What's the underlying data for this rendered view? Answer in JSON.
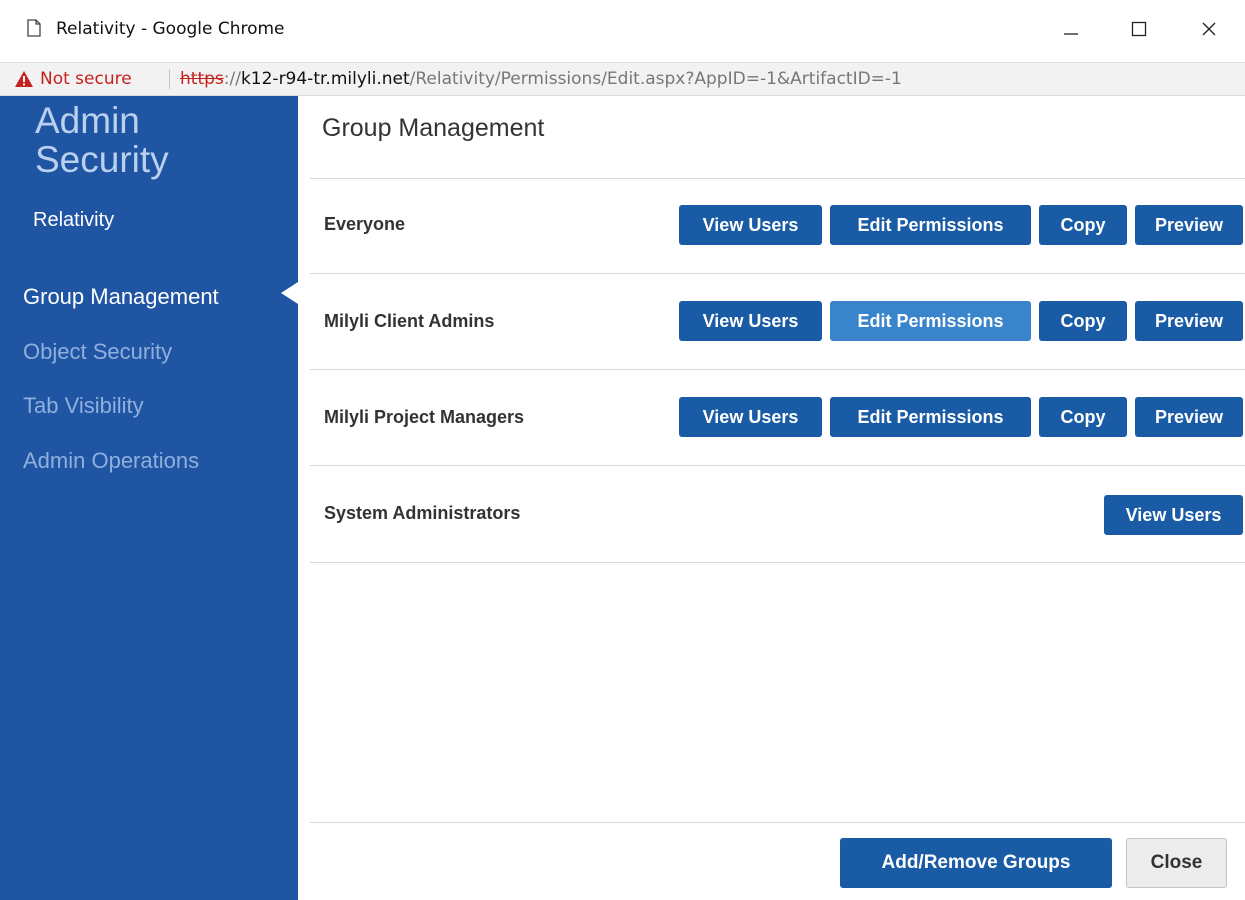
{
  "window": {
    "title": "Relativity - Google Chrome",
    "icons": {
      "page": "page-icon",
      "minimize": "minimize-icon",
      "maximize": "maximize-icon",
      "close": "close-icon"
    }
  },
  "addressbar": {
    "security_label": "Not secure",
    "url_scheme": "https",
    "url_sep": "://",
    "url_host": "k12-r94-tr.milyli.net",
    "url_path": "/Relativity/Permissions/Edit.aspx?AppID=-1&ArtifactID=-1",
    "icon": "warning-icon"
  },
  "sidebar": {
    "title": "Admin Security",
    "subtitle": "Relativity",
    "items": [
      {
        "label": "Group Management",
        "active": true
      },
      {
        "label": "Object Security",
        "active": false
      },
      {
        "label": "Tab Visibility",
        "active": false
      },
      {
        "label": "Admin Operations",
        "active": false
      }
    ]
  },
  "main": {
    "title": "Group Management",
    "groups": [
      {
        "name": "Everyone",
        "buttons": [
          "View Users",
          "Edit Permissions",
          "Copy",
          "Preview"
        ]
      },
      {
        "name": "Milyli Client Admins",
        "buttons": [
          "View Users",
          "Edit Permissions",
          "Copy",
          "Preview"
        ]
      },
      {
        "name": "Milyli Project Managers",
        "buttons": [
          "View Users",
          "Edit Permissions",
          "Copy",
          "Preview"
        ]
      },
      {
        "name": "System Administrators",
        "buttons": [
          "View Users"
        ]
      }
    ]
  },
  "footer": {
    "primary_label": "Add/Remove Groups",
    "secondary_label": "Close"
  },
  "colors": {
    "sidebar_bg": "#1f55a3",
    "button_bg": "#1a5ba6",
    "button_hover_bg": "#3a84cc",
    "warning": "#c5221f"
  }
}
